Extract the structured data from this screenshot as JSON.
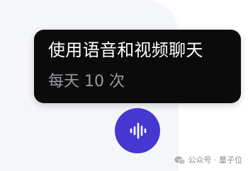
{
  "tooltip": {
    "title": "使用语音和视频聊天",
    "quota": "每天 10 次"
  },
  "voice_button": {
    "icon": "audio-waveform-icon",
    "color": "#4637d3"
  },
  "watermark": {
    "icon": "wechat-icon",
    "text": "公众号 · 量子位"
  },
  "colors": {
    "tooltip_bg": "#0b0b0c",
    "panel_bg": "#f5f6f9"
  }
}
